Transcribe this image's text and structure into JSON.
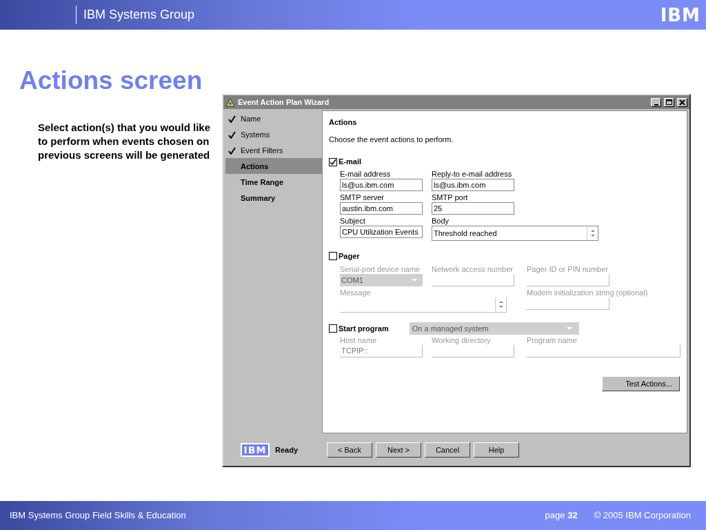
{
  "header": {
    "title": "IBM Systems Group",
    "logo": "IBM"
  },
  "slide_title": "Actions screen",
  "description": "Select action(s)  that you would like to perform when events chosen on previous screens will be generated",
  "window": {
    "title": "Event Action Plan Wizard",
    "steps": [
      {
        "label": "Name",
        "done": true,
        "selected": false
      },
      {
        "label": "Systems",
        "done": true,
        "selected": false
      },
      {
        "label": "Event Filters",
        "done": true,
        "selected": false
      },
      {
        "label": "Actions",
        "done": false,
        "selected": true
      },
      {
        "label": "Time Range",
        "done": false,
        "selected": false
      },
      {
        "label": "Summary",
        "done": false,
        "selected": false
      }
    ],
    "heading": "Actions",
    "instruction": "Choose the event actions to perform.",
    "sections": [
      {
        "kind": "email",
        "label": "E-mail",
        "checked": true,
        "fields": [
          {
            "kind": "text",
            "label": "E-mail address",
            "value": "ls@us.ibm.com",
            "disabled": false
          },
          {
            "kind": "text",
            "label": "Reply-to e-mail address",
            "value": "ls@us.ibm.com",
            "disabled": false
          },
          {
            "kind": "gap"
          },
          {
            "kind": "text",
            "label": "SMTP server",
            "value": "austin.ibm.com",
            "disabled": false
          },
          {
            "kind": "text",
            "label": "SMTP port",
            "value": "25",
            "disabled": false
          },
          {
            "kind": "gap"
          },
          {
            "kind": "text",
            "label": "Subject",
            "value": "CPU Utilization Events",
            "disabled": false
          },
          {
            "kind": "textarea",
            "label": "Body",
            "value": "Threshold reached",
            "disabled": false
          }
        ]
      },
      {
        "kind": "pager",
        "label": "Pager",
        "checked": false,
        "fields": [
          {
            "kind": "dropdown",
            "label": "Serial-port device name",
            "value": "COM1",
            "disabled": true
          },
          {
            "kind": "text",
            "label": "Network access number",
            "disabled": true
          },
          {
            "kind": "text",
            "label": "Pager ID or PIN number",
            "disabled": true
          },
          {
            "kind": "textarea",
            "label": "Message",
            "disabled": true
          },
          {
            "kind": "text",
            "label": "Modem initialization string (optional)",
            "disabled": true
          }
        ]
      },
      {
        "kind": "program",
        "label": "Start program",
        "checked": false,
        "location": {
          "value": "On a managed system",
          "disabled": true
        },
        "fields": [
          {
            "kind": "text",
            "label": "Host name",
            "value": "TCPIP::",
            "disabled": true
          },
          {
            "kind": "text",
            "label": "Working directory",
            "disabled": true
          },
          {
            "kind": "wide",
            "label": "Program name",
            "disabled": true
          }
        ]
      }
    ],
    "test_button": "Test Actions...",
    "status": {
      "logo": "IBM",
      "text": "Ready"
    },
    "buttons": [
      "< Back",
      "Next >",
      "Cancel",
      "Help"
    ]
  },
  "footer": {
    "left": "IBM Systems Group Field Skills & Education",
    "page_label": "page",
    "page_number": "32",
    "copyright": "© 2005 IBM Corporation"
  }
}
